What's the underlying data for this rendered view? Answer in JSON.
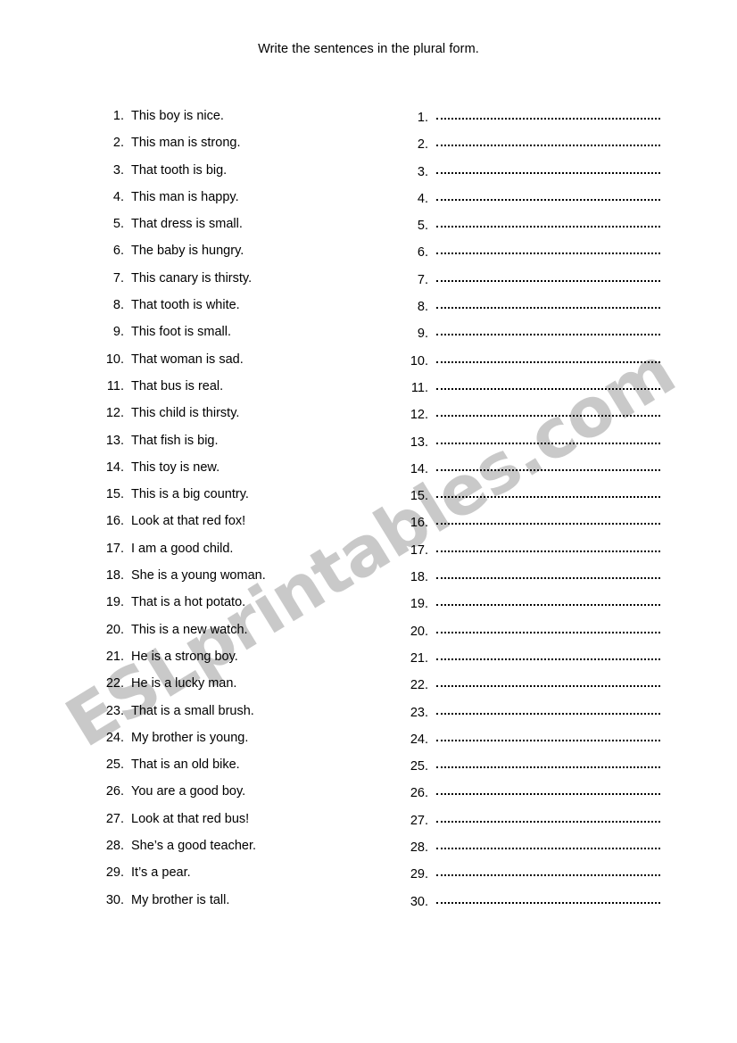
{
  "document": {
    "title": "Write the sentences in the plural form.",
    "watermark": "ESLprintables.com",
    "watermark_color": "#c9c9c9",
    "text_color": "#000000",
    "background_color": "#ffffff"
  },
  "exercise": {
    "prompt_column": {
      "items": [
        {
          "number": "1.",
          "text": "This boy is nice."
        },
        {
          "number": "2.",
          "text": "This man is strong."
        },
        {
          "number": "3.",
          "text": "That tooth is big."
        },
        {
          "number": "4.",
          "text": "This man is happy."
        },
        {
          "number": "5.",
          "text": "That dress is small."
        },
        {
          "number": "6.",
          "text": "The baby is hungry."
        },
        {
          "number": "7.",
          "text": "This canary is thirsty."
        },
        {
          "number": "8.",
          "text": "That tooth is white."
        },
        {
          "number": "9.",
          "text": "This foot is small."
        },
        {
          "number": "10.",
          "text": "That woman is sad."
        },
        {
          "number": "11.",
          "text": "That bus is real."
        },
        {
          "number": "12.",
          "text": "This child is thirsty."
        },
        {
          "number": "13.",
          "text": "That fish is big."
        },
        {
          "number": "14.",
          "text": "This toy is new."
        },
        {
          "number": "15.",
          "text": "This is a big country."
        },
        {
          "number": "16.",
          "text": "Look at that red fox!"
        },
        {
          "number": "17.",
          "text": "I am a good child."
        },
        {
          "number": "18.",
          "text": "She is a young woman."
        },
        {
          "number": "19.",
          "text": "That is a hot potato."
        },
        {
          "number": "20.",
          "text": "This is a new watch."
        },
        {
          "number": "21.",
          "text": "He is a strong boy."
        },
        {
          "number": "22.",
          "text": "He is a lucky man."
        },
        {
          "number": "23.",
          "text": "That is a small brush."
        },
        {
          "number": "24.",
          "text": "My brother is young."
        },
        {
          "number": "25.",
          "text": "That is an old bike."
        },
        {
          "number": "26.",
          "text": "You are a good boy."
        },
        {
          "number": "27.",
          "text": "Look at that red bus!"
        },
        {
          "number": "28.",
          "text": "She’s a good teacher."
        },
        {
          "number": "29.",
          "text": "It’s a pear."
        },
        {
          "number": "30.",
          "text": "My brother is tall."
        }
      ]
    },
    "answer_column": {
      "items": [
        {
          "number": "1.",
          "value": ""
        },
        {
          "number": "2.",
          "value": ""
        },
        {
          "number": "3.",
          "value": ""
        },
        {
          "number": "4.",
          "value": ""
        },
        {
          "number": "5.",
          "value": ""
        },
        {
          "number": "6.",
          "value": ""
        },
        {
          "number": "7.",
          "value": ""
        },
        {
          "number": "8.",
          "value": ""
        },
        {
          "number": "9.",
          "value": ""
        },
        {
          "number": "10.",
          "value": ""
        },
        {
          "number": "11.",
          "value": ""
        },
        {
          "number": "12.",
          "value": ""
        },
        {
          "number": "13.",
          "value": ""
        },
        {
          "number": "14.",
          "value": ""
        },
        {
          "number": "15.",
          "value": ""
        },
        {
          "number": "16.",
          "value": ""
        },
        {
          "number": "17.",
          "value": ""
        },
        {
          "number": "18.",
          "value": ""
        },
        {
          "number": "19.",
          "value": ""
        },
        {
          "number": "20.",
          "value": ""
        },
        {
          "number": "21.",
          "value": ""
        },
        {
          "number": "22.",
          "value": ""
        },
        {
          "number": "23.",
          "value": ""
        },
        {
          "number": "24.",
          "value": ""
        },
        {
          "number": "25.",
          "value": ""
        },
        {
          "number": "26.",
          "value": ""
        },
        {
          "number": "27.",
          "value": ""
        },
        {
          "number": "28.",
          "value": ""
        },
        {
          "number": "29.",
          "value": ""
        },
        {
          "number": "30.",
          "value": ""
        }
      ]
    }
  }
}
